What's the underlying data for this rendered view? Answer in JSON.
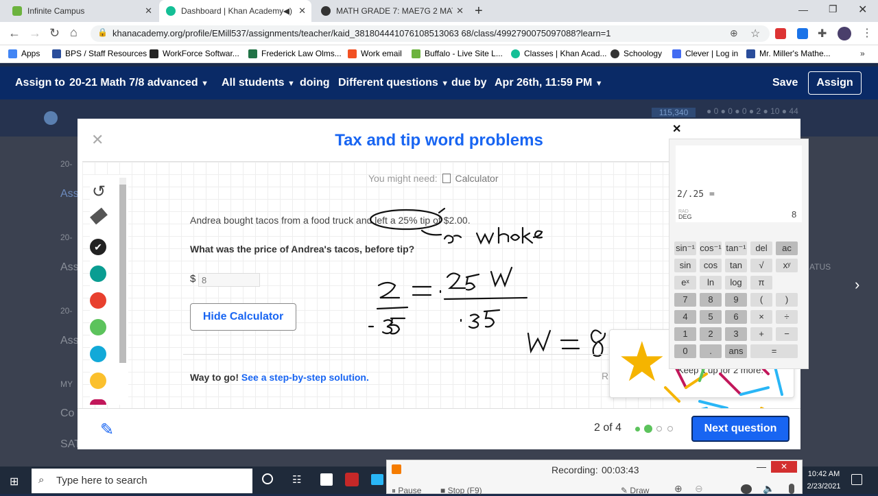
{
  "tabs": [
    {
      "label": "Infinite Campus",
      "active": false
    },
    {
      "label": "Dashboard | Khan Academy",
      "active": true
    },
    {
      "label": "MATH GRADE 7: MAE7G 2 MATH",
      "active": false
    }
  ],
  "url": "khanacademy.org/profile/EMill537/assignments/teacher/kaid_381804441076108513063 68/class/4992790075097088?learn=1",
  "bookmarks": [
    "Apps",
    "BPS / Staff Resources",
    "WorkForce Softwar...",
    "Frederick Law Olms...",
    "Work email",
    "Buffalo - Live Site L...",
    "Classes | Khan Acad...",
    "Schoology",
    "Clever | Log in",
    "Mr. Miller's Mathe..."
  ],
  "header": {
    "assign_to": "Assign to",
    "class_name": "20-21 Math 7/8 advanced",
    "students": "All students",
    "doing": "doing",
    "questions": "Different questions",
    "due_by": "due by",
    "due_date": "Apr 26th, 11:59 PM",
    "save": "Save",
    "assign": "Assign"
  },
  "stats": {
    "points": "115,340",
    "s1": "0",
    "s2": "0",
    "s3": "0",
    "s4": "2",
    "s5": "10",
    "s6": "44"
  },
  "background": {
    "labels": [
      "20-",
      "Ass",
      "20-",
      "Ass",
      "20-",
      "Ass",
      "MY",
      "Co",
      "SAT"
    ],
    "status": "ATUS"
  },
  "modal": {
    "title": "Tax and tip word problems",
    "might_need": "You might need:",
    "calculator_label": "Calculator",
    "question_text": "Andrea bought tacos from a food truck and left a 25% tip of $2.00.",
    "question_prompt": "What was the price of Andrea's tacos, before tip?",
    "dollar": "$",
    "answer_value": "8",
    "hide_calculator": "Hide Calculator",
    "way_to_go": "Way to go!",
    "step_solution": "See a step-by-step solution.",
    "r_char": "R",
    "keep_it_up": "Keep it up for 2 more.",
    "progress": "2 of 4",
    "next_question": "Next question"
  },
  "calculator": {
    "expression": "2/.25 =",
    "rad": "RAD",
    "deg": "DEG",
    "result": "8",
    "keys": [
      [
        "sin⁻¹",
        "cos⁻¹",
        "tan⁻¹",
        "del",
        "ac"
      ],
      [
        "sin",
        "cos",
        "tan",
        "√",
        "xʸ"
      ],
      [
        "eˣ",
        "ln",
        "log",
        "π",
        ""
      ],
      [
        "7",
        "8",
        "9",
        "(",
        ")"
      ],
      [
        "4",
        "5",
        "6",
        "×",
        "÷"
      ],
      [
        "1",
        "2",
        "3",
        "+",
        "−"
      ],
      [
        "0",
        ".",
        "ans",
        "=",
        ""
      ]
    ]
  },
  "taskbar": {
    "search_placeholder": "Type here to search",
    "recording_label": "Recording:",
    "recording_time": "00:03:43",
    "time": "10:42 AM",
    "date": "2/23/2021",
    "pause": "Pause",
    "stop": "Stop (F9)",
    "draw": "Draw"
  }
}
